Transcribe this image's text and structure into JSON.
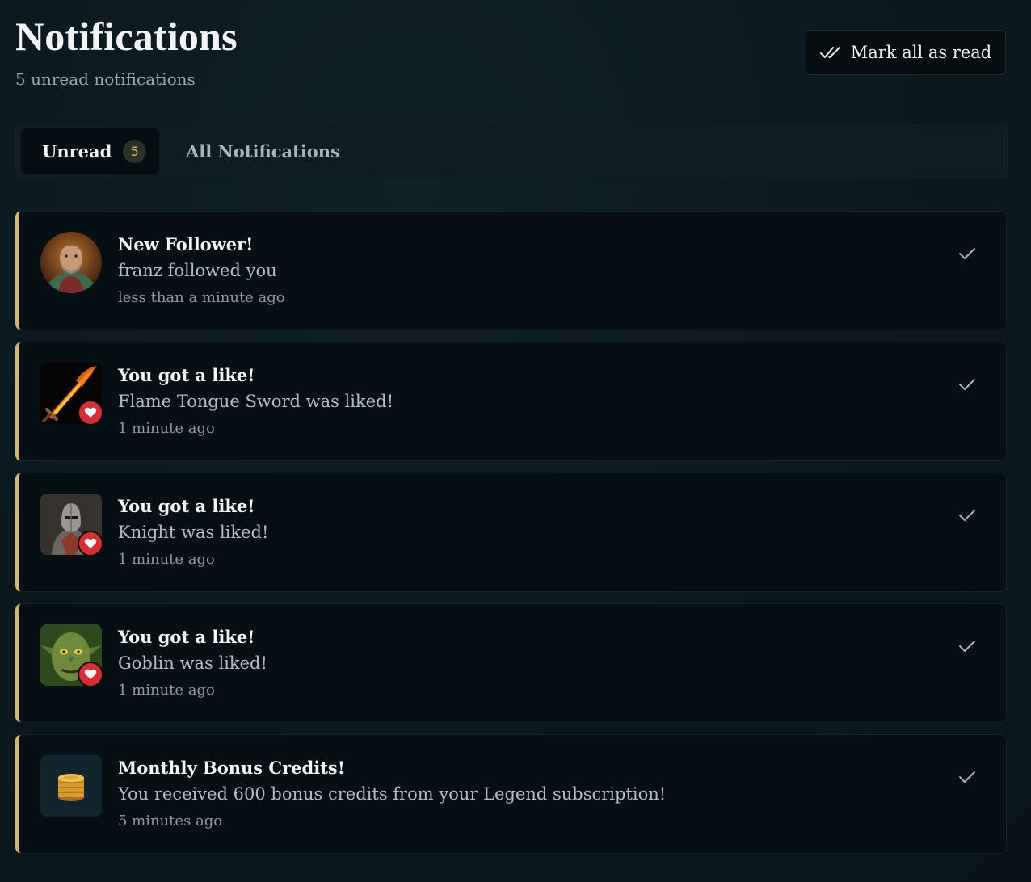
{
  "header": {
    "title": "Notifications",
    "subtitle": "5 unread notifications",
    "mark_all_label": "Mark all as read"
  },
  "tabs": [
    {
      "label": "Unread",
      "badge": "5",
      "active": true
    },
    {
      "label": "All Notifications",
      "active": false
    }
  ],
  "notifications": [
    {
      "title": "New Follower!",
      "body": "franz followed you",
      "time": "less than a minute ago",
      "icon": "user-avatar",
      "unread": true
    },
    {
      "title": "You got a like!",
      "body": "Flame Tongue Sword was liked!",
      "time": "1 minute ago",
      "icon": "flame-sword-thumbnail",
      "unread": true
    },
    {
      "title": "You got a like!",
      "body": "Knight was liked!",
      "time": "1 minute ago",
      "icon": "knight-thumbnail",
      "unread": true
    },
    {
      "title": "You got a like!",
      "body": "Goblin was liked!",
      "time": "1 minute ago",
      "icon": "goblin-thumbnail",
      "unread": true
    },
    {
      "title": "Monthly Bonus Credits!",
      "body": "You received 600 bonus credits from your Legend subscription!",
      "time": "5 minutes ago",
      "icon": "coins-icon",
      "unread": true
    }
  ],
  "colors": {
    "accent": "#d8b56a",
    "heart": "#d92d32",
    "badge_text": "#e2b458"
  }
}
